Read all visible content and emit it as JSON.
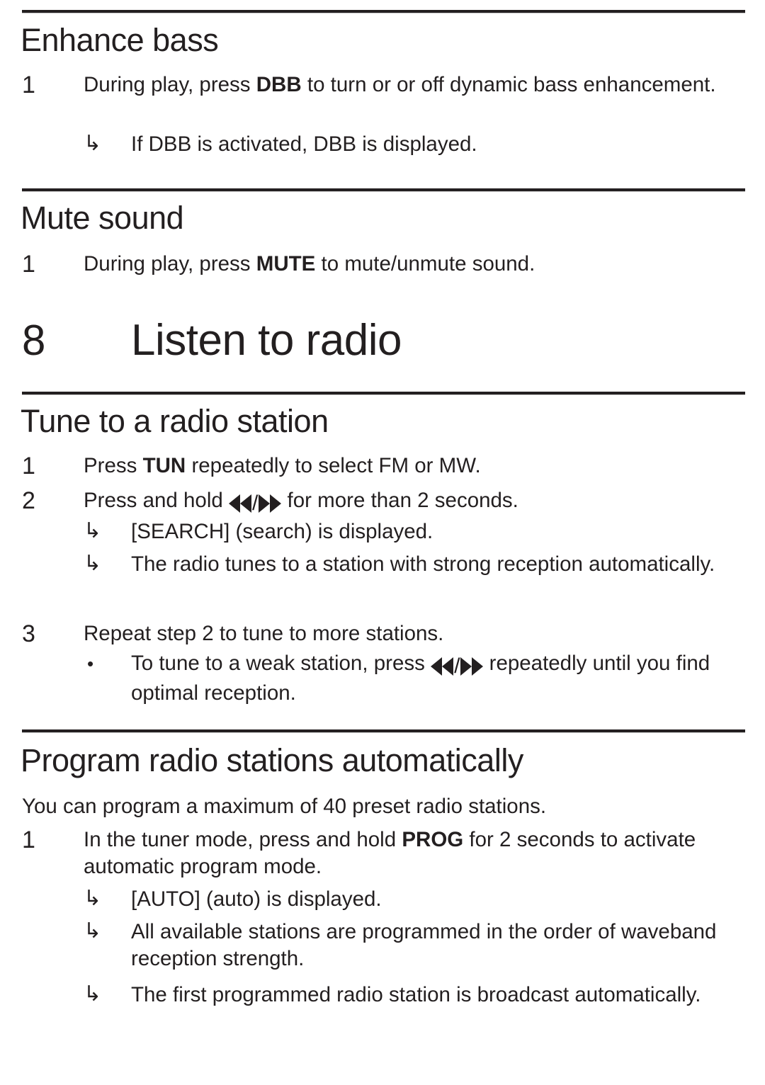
{
  "page": {
    "text_color": "#231f20",
    "background": "#ffffff"
  },
  "sections": {
    "enhance_bass": {
      "heading": "Enhance bass",
      "step1_num": "1",
      "step1_part1": "During play, press ",
      "step1_key": "DBB",
      "step1_part2": " to turn or or off dynamic bass enhancement.",
      "arrow_marker": "↳",
      "result1": "If DBB is activated, DBB is displayed."
    },
    "mute_sound": {
      "heading": "Mute sound",
      "step1_num": "1",
      "step1_part1": "During play, press ",
      "step1_key": "MUTE",
      "step1_part2": " to mute/unmute sound."
    },
    "chapter": {
      "number": "8",
      "title": "Listen to radio"
    },
    "tune_radio": {
      "heading": "Tune to a radio station",
      "step1_num": "1",
      "step1_part1": "Press ",
      "step1_key": "TUN",
      "step1_part2": " repeatedly to select FM or MW.",
      "step2_num": "2",
      "step2_part1": "Press and hold ",
      "step2_part2": " for more than 2 seconds.",
      "arrow_marker": "↳",
      "result1": "[SEARCH] (search) is displayed.",
      "result2": "The radio tunes to a station with strong reception automatically.",
      "step3_num": "3",
      "step3_text": "Repeat step 2 to tune to more stations.",
      "bullet_marker": "•",
      "tip_part1": "To tune to a weak station, press ",
      "tip_part2": " repeatedly until you find optimal reception."
    },
    "program_radio": {
      "heading": "Program radio stations automatically",
      "intro": "You can program a maximum of 40 preset radio stations.",
      "step1_num": "1",
      "step1_part1": "In the tuner mode, press and hold ",
      "step1_key": "PROG",
      "step1_part2": " for 2 seconds to activate automatic program mode.",
      "arrow_marker": "↳",
      "result1": "[AUTO] (auto) is displayed.",
      "result2": "All available stations are programmed in the order of waveband reception strength.",
      "result3": "The first programmed radio station is broadcast automatically."
    }
  }
}
